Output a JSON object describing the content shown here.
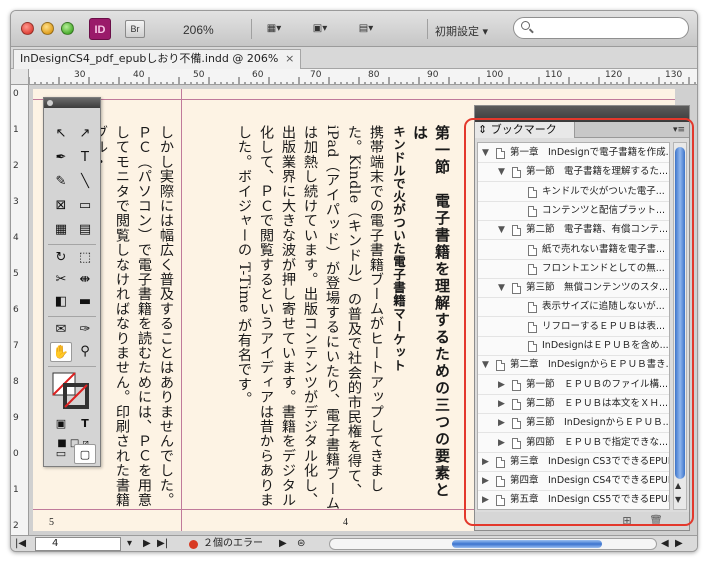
{
  "toolbar": {
    "app_icon": "ID",
    "bridge_icon": "Br",
    "zoom": "206%",
    "workspace": "初期設定 ▾",
    "search_placeholder": ""
  },
  "document_tab": {
    "title": "InDesignCS4_pdf_epubしおり不備.indd @ 206%",
    "close": "×"
  },
  "ruler": {
    "h_labels": [
      "30",
      "40",
      "50",
      "60",
      "70",
      "80",
      "90",
      "100",
      "110",
      "120",
      "130"
    ],
    "v_labels": [
      "0",
      "1",
      "2",
      "3",
      "4",
      "5",
      "6",
      "7",
      "8",
      "9",
      "0",
      "1",
      "2"
    ]
  },
  "page": {
    "right_text": {
      "heading": "第一節　電子書籍を理解するための三つの要素とは",
      "subhead": "キンドルで火がついた電子書籍マーケット",
      "body": "携帯端末での電子書籍ブームがヒートアップしてきました。Kindle（キンドル）の普及で社会的市民権を得て、iPad（アイパッド）が登場するにいたり、電子書籍ブームは加熱し続けています。出版コンテンツがデジタル化し、出版業界に大きな波が押し寄せています。書籍をデジタル化して、ＰＣで閲覧するというアイディアは昔からありました。ボイジャーの T-Time が有名です。"
    },
    "left_text": {
      "body": "しかし実際には幅広く普及することはありませんでした。ＰＣ（パソコン）で電子書籍を読むためには、ＰＣを用意してモニタで閲覧しなければなりません。印刷された書籍ブル・"
    },
    "page_number_left": "5",
    "page_number_right": "4"
  },
  "bookmarks": {
    "tab_label": "ブックマーク",
    "menu_icon": "▾≡",
    "items": [
      {
        "label": "第一章　InDesignで電子書籍を作成...",
        "level": 0,
        "tri": "▼"
      },
      {
        "label": "第一節　電子書籍を理解するた...",
        "level": 1,
        "tri": "▼"
      },
      {
        "label": "キンドルで火がついた電子...",
        "level": 2,
        "tri": ""
      },
      {
        "label": "コンテンツと配信プラット...",
        "level": 2,
        "tri": ""
      },
      {
        "label": "第二節　電子書籍、有償コンテ...",
        "level": 1,
        "tri": "▼"
      },
      {
        "label": "紙で売れない書籍を電子書...",
        "level": 2,
        "tri": ""
      },
      {
        "label": "フロントエンドとしての無...",
        "level": 2,
        "tri": ""
      },
      {
        "label": "第三節　無償コンテンツのスタ...",
        "level": 1,
        "tri": "▼"
      },
      {
        "label": "表示サイズに追随しないが...",
        "level": 2,
        "tri": ""
      },
      {
        "label": "リフローするＥＰＵＢは表...",
        "level": 2,
        "tri": ""
      },
      {
        "label": "InDesignはＥＰＵＢを含め...",
        "level": 2,
        "tri": ""
      },
      {
        "label": "第二章　InDesignからＥＰＵＢ書き...",
        "level": 0,
        "tri": "▼"
      },
      {
        "label": "第一節　ＥＰＵＢのファイル構...",
        "level": 1,
        "tri": "▶"
      },
      {
        "label": "第二節　ＥＰＵＢは本文をＸＨ...",
        "level": 1,
        "tri": "▶"
      },
      {
        "label": "第三節　InDesignからＥＰＵＢ...",
        "level": 1,
        "tri": "▶"
      },
      {
        "label": "第四節　ＥＰＵＢで指定できな...",
        "level": 1,
        "tri": "▶"
      },
      {
        "label": "第三章　InDesign CS3でできるEPUB...",
        "level": 0,
        "tri": "▶"
      },
      {
        "label": "第四章　InDesign CS4でできるEPUB...",
        "level": 0,
        "tri": "▶"
      },
      {
        "label": "第五章　InDesign CS5でできるEPUB...",
        "level": 0,
        "tri": "▶"
      }
    ]
  },
  "status": {
    "page": "4",
    "errors": "２個のエラー"
  },
  "colors": {
    "highlight_frame": "#e3382c",
    "page_bg": "#fdf3e4",
    "scroll_thumb": "#3d74c9"
  }
}
